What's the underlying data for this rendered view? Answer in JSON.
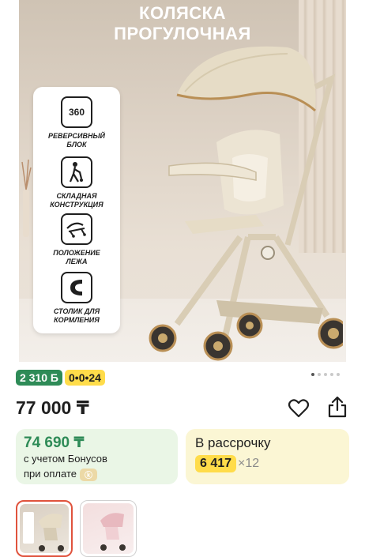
{
  "hero": {
    "title_line1": "КОЛЯСКА",
    "title_line2": "ПРОГУЛОЧНАЯ",
    "features": [
      {
        "icon": "rotate-360-icon",
        "icon_text": "360",
        "label": "РЕВЕРСИВНЫЙ\nБЛОК"
      },
      {
        "icon": "folding-stroller-icon",
        "icon_text": "",
        "label": "СКЛАДНАЯ\nКОНСТРУКЦИЯ"
      },
      {
        "icon": "recline-position-icon",
        "icon_text": "",
        "label": "ПОЛОЖЕНИЕ\nЛЕЖА"
      },
      {
        "icon": "feeding-tray-icon",
        "icon_text": "",
        "label": "СТОЛИК ДЛЯ\nКОРМЛЕНИЯ"
      }
    ],
    "gallery_pages": 5,
    "active_page": 0
  },
  "badges": {
    "bonus": "2 310 Б",
    "installment": "0•0•24"
  },
  "price": {
    "main": "77 000 ₸"
  },
  "bonus_box": {
    "price": "74 690 ₸",
    "line1": "с учетом Бонусов",
    "line2": "при оплате"
  },
  "installment_box": {
    "title": "В рассрочку",
    "amount": "6 417",
    "multiplier": "×12"
  },
  "colors": {
    "accent_green": "#2e8b57",
    "accent_yellow": "#ffdc4a",
    "thumb_selected": "#e0533d"
  }
}
